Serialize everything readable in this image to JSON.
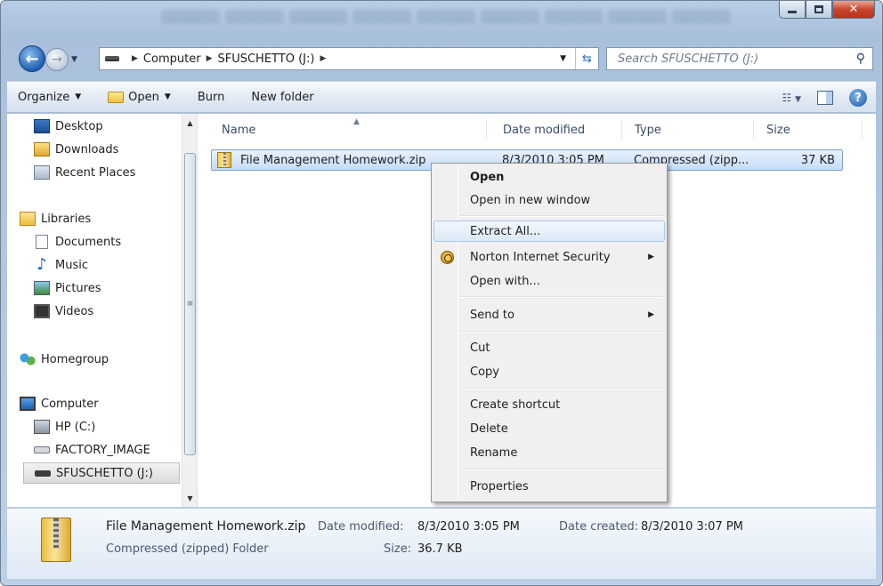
{
  "address": {
    "crumbs": [
      "Computer",
      "SFUSCHETTO (J:)"
    ],
    "search_placeholder": "Search SFUSCHETTO (J:)"
  },
  "toolbar": {
    "organize": "Organize",
    "open": "Open",
    "burn": "Burn",
    "new_folder": "New folder"
  },
  "nav": {
    "favorites": [
      "Desktop",
      "Downloads",
      "Recent Places"
    ],
    "libraries": "Libraries",
    "library_items": [
      "Documents",
      "Music",
      "Pictures",
      "Videos"
    ],
    "homegroup": "Homegroup",
    "computer": "Computer",
    "drives": [
      "HP (C:)",
      "FACTORY_IMAGE",
      "SFUSCHETTO (J:)"
    ]
  },
  "columns": {
    "name": "Name",
    "date": "Date modified",
    "type": "Type",
    "size": "Size"
  },
  "file": {
    "name": "File Management Homework.zip",
    "date": "8/3/2010 3:05 PM",
    "type": "Compressed (zipp...",
    "size": "37 KB"
  },
  "context_menu": {
    "open": "Open",
    "open_new_window": "Open in new window",
    "extract_all": "Extract All...",
    "norton": "Norton Internet Security",
    "open_with": "Open with...",
    "send_to": "Send to",
    "cut": "Cut",
    "copy": "Copy",
    "create_shortcut": "Create shortcut",
    "delete": "Delete",
    "rename": "Rename",
    "properties": "Properties"
  },
  "details": {
    "name": "File Management Homework.zip",
    "type": "Compressed (zipped) Folder",
    "modified_label": "Date modified:",
    "modified_value": "8/3/2010 3:05 PM",
    "created_label": "Date created:",
    "created_value": "8/3/2010 3:07 PM",
    "size_label": "Size:",
    "size_value": "36.7 KB"
  }
}
